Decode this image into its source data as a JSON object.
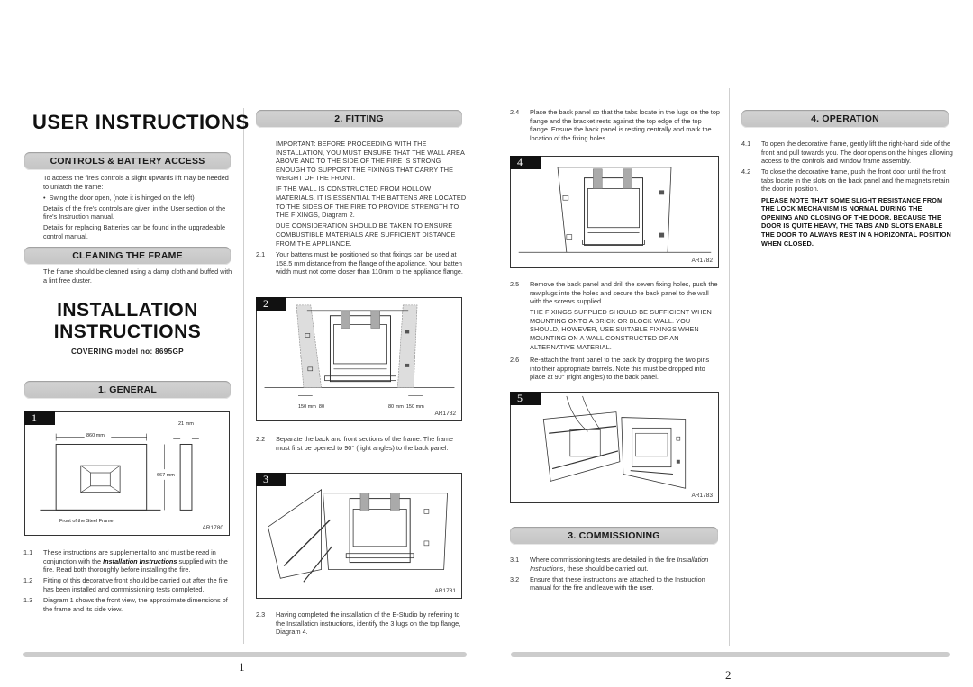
{
  "page1": {
    "title": "USER INSTRUCTIONS",
    "controls": {
      "heading": "CONTROLS & BATTERY ACCESS",
      "p1": "To access the fire's controls a slight upwards lift may be needed to unlatch the frame:",
      "bullet": "Swing the door open, (note it is hinged on the left)",
      "p2": "Details of the fire's controls are given in the User section of the fire's Instruction manual.",
      "p3": "Details for replacing Batteries can be found in the upgradeable control manual."
    },
    "cleaning": {
      "heading": "CLEANING THE FRAME",
      "p1": "The frame should be cleaned using a damp cloth and buffed with a lint free duster."
    },
    "install_title_1": "INSTALLATION",
    "install_title_2": "INSTRUCTIONS",
    "model": "COVERING model no: 8695GP",
    "general": {
      "heading": "1. GENERAL",
      "items": [
        {
          "num": "1.1",
          "pre": "These instructions are supplemental to and must be read in conjunction with the ",
          "em": "Installation Instructions",
          "post": " supplied with the fire. Read both thoroughly before installing the fire."
        },
        {
          "num": "1.2",
          "text": "Fitting of this decorative front should be carried out after the fire has been installed and commissioning tests completed."
        },
        {
          "num": "1.3",
          "text": "Diagram 1 shows the front view, the approximate dimensions of the frame and its side view."
        }
      ]
    },
    "diagram1": {
      "number": "1",
      "code": "AR1780",
      "width_label": "860 mm",
      "depth_label": "21 mm",
      "height_label": "667 mm",
      "caption": "Front of the Steel Frame"
    },
    "fitting": {
      "heading": "2. FITTING",
      "warn1": "IMPORTANT: BEFORE PROCEEDING WITH THE INSTALLATION, YOU MUST ENSURE THAT THE WALL AREA ABOVE AND TO THE SIDE OF THE FIRE IS STRONG ENOUGH TO SUPPORT THE FIXINGS THAT CARRY THE WEIGHT OF THE FRONT.",
      "warn2": "IF THE WALL IS CONSTRUCTED FROM HOLLOW MATERIALS, IT IS ESSENTIAL THE BATTENS ARE LOCATED TO THE SIDES OF THE FIRE TO PROVIDE STRENGTH TO THE FIXINGS, Diagram 2.",
      "warn3": "DUE CONSIDERATION SHOULD BE TAKEN TO ENSURE COMBUSTIBLE MATERIALS ARE SUFFICIENT DISTANCE FROM THE APPLIANCE.",
      "items": [
        {
          "num": "2.1",
          "text": "Your battens must be positioned so that fixings can be used at 158.5 mm distance from the flange of the appliance. Your batten width must not come closer than 110mm to the appliance flange."
        },
        {
          "num": "2.2",
          "text": "Separate the back and front sections of the frame. The frame must first be opened to 90° (right angles) to the back panel."
        },
        {
          "num": "2.3",
          "text": "Having completed the installation of the E-Studio by referring to the Installation instructions, identify the 3 lugs on the top flange, Diagram 4."
        }
      ]
    },
    "diagram2": {
      "number": "2",
      "code": "AR1782",
      "left_label": "150 mm  80",
      "right_label": "80 mm  150 mm"
    },
    "diagram3": {
      "number": "3",
      "code": "AR1781"
    },
    "page_number": "1"
  },
  "page2": {
    "items_top": [
      {
        "num": "2.4",
        "text": "Place the back panel so that the tabs locate in the lugs on the top flange and the bracket rests against the top edge of the top flange. Ensure the back panel is resting centrally and mark the location of the fixing holes."
      }
    ],
    "diagram4": {
      "number": "4",
      "code": "AR1782"
    },
    "item25": {
      "num": "2.5",
      "text": "Remove the back panel and drill the seven fixing holes, push the rawlplugs into the holes and secure the back panel to the wall with the screws supplied."
    },
    "warn25": "THE FIXINGS SUPPLIED SHOULD BE SUFFICIENT WHEN MOUNTING ONTO A BRICK OR BLOCK WALL. YOU SHOULD, HOWEVER, USE SUITABLE FIXINGS WHEN MOUNTING ON A WALL CONSTRUCTED OF AN ALTERNATIVE MATERIAL.",
    "item26": {
      "num": "2.6",
      "text": "Re-attach the front panel to the back by dropping the two pins into their appropriate barrels. Note this must be dropped into place at 90° (right angles) to the back panel."
    },
    "diagram5": {
      "number": "5",
      "code": "AR1783"
    },
    "commissioning": {
      "heading": "3. COMMISSIONING",
      "items": [
        {
          "num": "3.1",
          "pre": "Where commissioning tests are detailed in the fire ",
          "em": "Installation Instructions",
          "post": ", these should be carried out."
        },
        {
          "num": "3.2",
          "text": "Ensure that these instructions are attached to the Instruction manual for the fire and leave with the user."
        }
      ]
    },
    "operation": {
      "heading": "4. OPERATION",
      "items": [
        {
          "num": "4.1",
          "text": "To open the decorative frame, gently lift the right-hand side of the front and pull towards you. The door opens on the hinges allowing access to the controls and window frame assembly."
        },
        {
          "num": "4.2",
          "text": "To close the decorative frame, push the front door until the front tabs locate in the slots on the back panel and the magnets retain the door in position."
        }
      ],
      "note": "PLEASE NOTE THAT SOME SLIGHT RESISTANCE FROM THE LOCK MECHANISM IS NORMAL DURING THE OPENING AND CLOSING OF THE DOOR. BECAUSE THE DOOR IS QUITE HEAVY, THE TABS AND SLOTS ENABLE THE DOOR TO ALWAYS REST IN A HORIZONTAL POSITION WHEN CLOSED."
    },
    "page_number": "2"
  }
}
